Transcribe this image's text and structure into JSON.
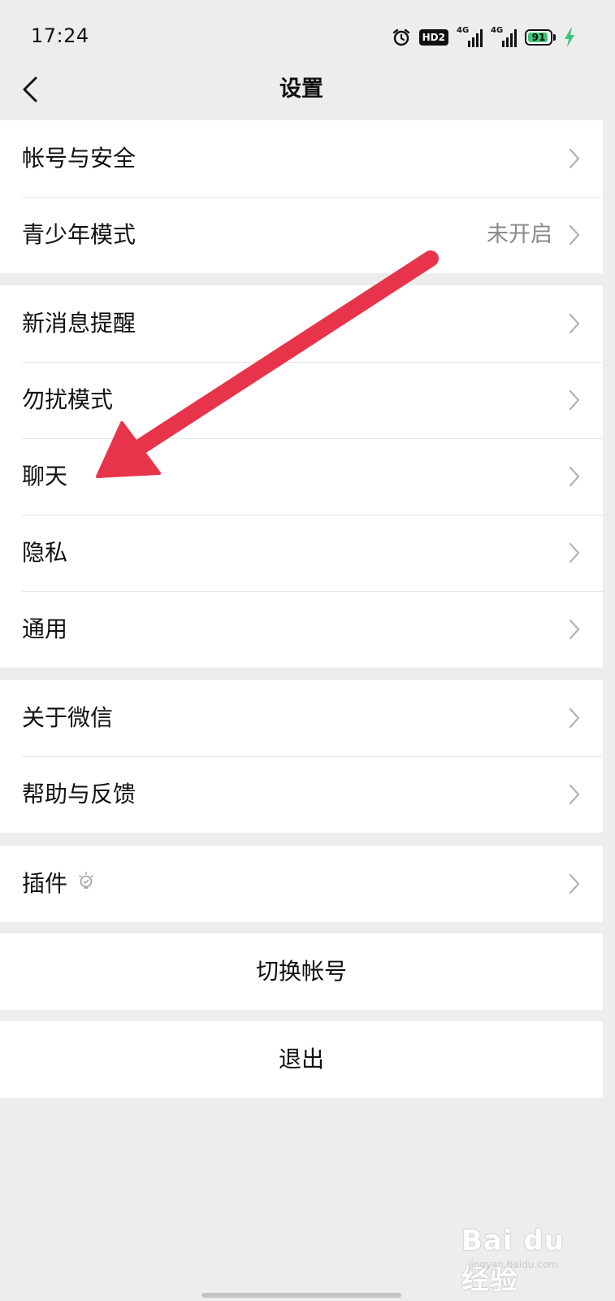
{
  "status_bar": {
    "time": "17:24",
    "hd_label": "HD2",
    "network_1": "4G",
    "network_2": "4G",
    "battery_level": "91",
    "icons": [
      "alarm-icon",
      "hd-voice-icon",
      "signal-icon",
      "signal-icon",
      "battery-icon",
      "charging-icon"
    ]
  },
  "nav": {
    "title": "设置",
    "back_icon": "chevron-left-icon"
  },
  "groups": [
    {
      "items": [
        {
          "label": "帐号与安全",
          "value": ""
        },
        {
          "label": "青少年模式",
          "value": "未开启"
        }
      ]
    },
    {
      "items": [
        {
          "label": "新消息提醒",
          "value": ""
        },
        {
          "label": "勿扰模式",
          "value": ""
        },
        {
          "label": "聊天",
          "value": ""
        },
        {
          "label": "隐私",
          "value": ""
        },
        {
          "label": "通用",
          "value": ""
        }
      ]
    },
    {
      "items": [
        {
          "label": "关于微信",
          "value": ""
        },
        {
          "label": "帮助与反馈",
          "value": ""
        }
      ]
    },
    {
      "items": [
        {
          "label": "插件",
          "value": "",
          "icon": "lightbulb-icon"
        }
      ]
    }
  ],
  "actions": {
    "switch_account": "切换帐号",
    "logout": "退出"
  },
  "annotation": {
    "arrow_color": "#e8344a",
    "points_to": "聊天"
  },
  "watermark": {
    "text": "Bai du 经验",
    "sub": "jingyan.baidu.com"
  },
  "colors": {
    "background": "#ededed",
    "card": "#ffffff",
    "secondary_text": "#8a8a8a",
    "divider": "#e5e5e5",
    "battery_fill": "#3fc47a"
  }
}
